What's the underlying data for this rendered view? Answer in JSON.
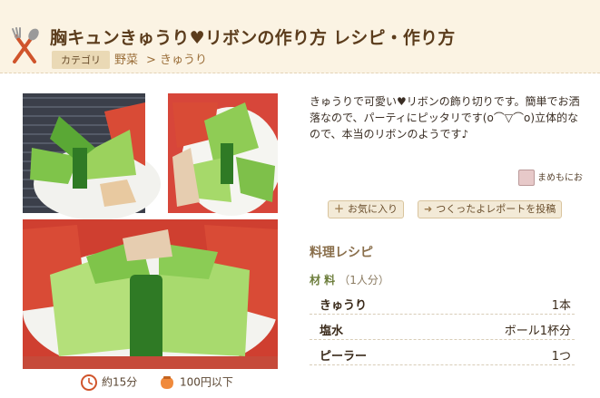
{
  "header": {
    "title": "胸キュンきゅうり♥リボンの作り方 レシピ・作り方",
    "category_label": "カテゴリ",
    "breadcrumbs": [
      "野菜",
      "> きゅうり"
    ]
  },
  "recipe": {
    "description": "きゅうりで可愛い♥リボンの飾り切りです。簡単でお洒落なので、パーティにピッタリです(o⌒▽⌒o)立体的なので、本当のリボンのようです♪",
    "author": "まめもにお",
    "time": "約15分",
    "cost": "100円以下",
    "buttons": {
      "favorite": "お気に入り",
      "report": "つくったよレポートを投稿"
    },
    "section_title": "料理レシピ",
    "ingredients_label": "材 料",
    "servings": "（1人分）",
    "ingredients": [
      {
        "name": "きゅうり",
        "qty": "1本"
      },
      {
        "name": "塩水",
        "qty": "ボール1杯分"
      },
      {
        "name": "ピーラー",
        "qty": "1つ"
      }
    ]
  },
  "colors": {
    "header_bg": "#fbf3e3",
    "title": "#5b3c1c",
    "link": "#9b6f3a",
    "ingredient_head": "#6c7d3b"
  },
  "icons": [
    "fork-spoon-icon",
    "clock-icon",
    "coin-purse-icon",
    "plus-icon",
    "arrow-right-icon"
  ]
}
